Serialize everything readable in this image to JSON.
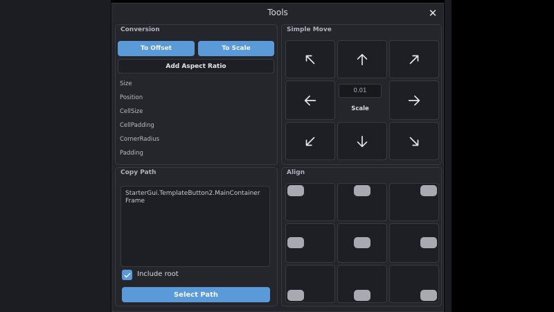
{
  "window": {
    "title": "Tools",
    "close_icon": "close-icon"
  },
  "conversion": {
    "title": "Conversion",
    "to_offset_label": "To Offset",
    "to_scale_label": "To Scale",
    "add_aspect_ratio_label": "Add Aspect Ratio",
    "properties": [
      "Size",
      "Position",
      "CellSize",
      "CellPadding",
      "CornerRadius",
      "Padding"
    ]
  },
  "simple_move": {
    "title": "Simple Move",
    "arrows": [
      "arrow-up-left-icon",
      "arrow-up-icon",
      "arrow-up-right-icon",
      "arrow-left-icon",
      "arrow-right-icon",
      "arrow-down-left-icon",
      "arrow-down-icon",
      "arrow-down-right-icon"
    ],
    "scale_value": "0.01",
    "scale_label": "Scale"
  },
  "copy_path": {
    "title": "Copy Path",
    "path_text": "StarterGui.TemplateButton2.MainContainer Frame",
    "include_root_label": "Include root",
    "include_root_checked": true,
    "select_path_label": "Select Path"
  },
  "align": {
    "title": "Align",
    "positions": [
      "top-left",
      "top-center",
      "top-right",
      "middle-left",
      "center",
      "middle-right",
      "bottom-left",
      "bottom-center",
      "bottom-right"
    ]
  },
  "colors": {
    "accent": "#5b9ad9",
    "window_bg": "#23252b",
    "panel_border": "#373a41",
    "align_marker": "#a8a9b1"
  }
}
